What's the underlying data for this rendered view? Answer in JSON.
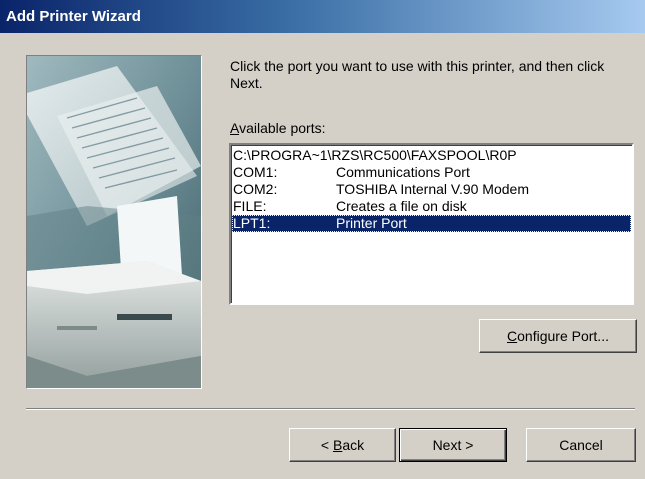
{
  "window": {
    "title": "Add Printer Wizard"
  },
  "instructions": "Click the port you want to use with this printer, and then click Next.",
  "ports_label": {
    "mnemonic": "A",
    "rest": "vailable ports:"
  },
  "ports": [
    {
      "port": "C:\\PROGRA~1\\RZS\\RC500\\FAXSPOOL\\R0P",
      "description": "",
      "selected": false,
      "full": true
    },
    {
      "port": "COM1:",
      "description": "Communications Port",
      "selected": false,
      "full": false
    },
    {
      "port": "COM2:",
      "description": "TOSHIBA Internal V.90 Modem",
      "selected": false,
      "full": false
    },
    {
      "port": "FILE:",
      "description": "Creates a file on disk",
      "selected": false,
      "full": false
    },
    {
      "port": "LPT1:",
      "description": "Printer Port",
      "selected": true,
      "full": false
    }
  ],
  "buttons": {
    "configure": {
      "mnemonic": "C",
      "rest": "onfigure Port..."
    },
    "back": {
      "prefix": "< ",
      "mnemonic": "B",
      "rest": "ack"
    },
    "next": "Next >",
    "cancel": "Cancel"
  },
  "colors": {
    "title_start": "#0a246a",
    "title_end": "#a6caf0",
    "selection": "#0a246a",
    "face": "#d4d0c8"
  }
}
